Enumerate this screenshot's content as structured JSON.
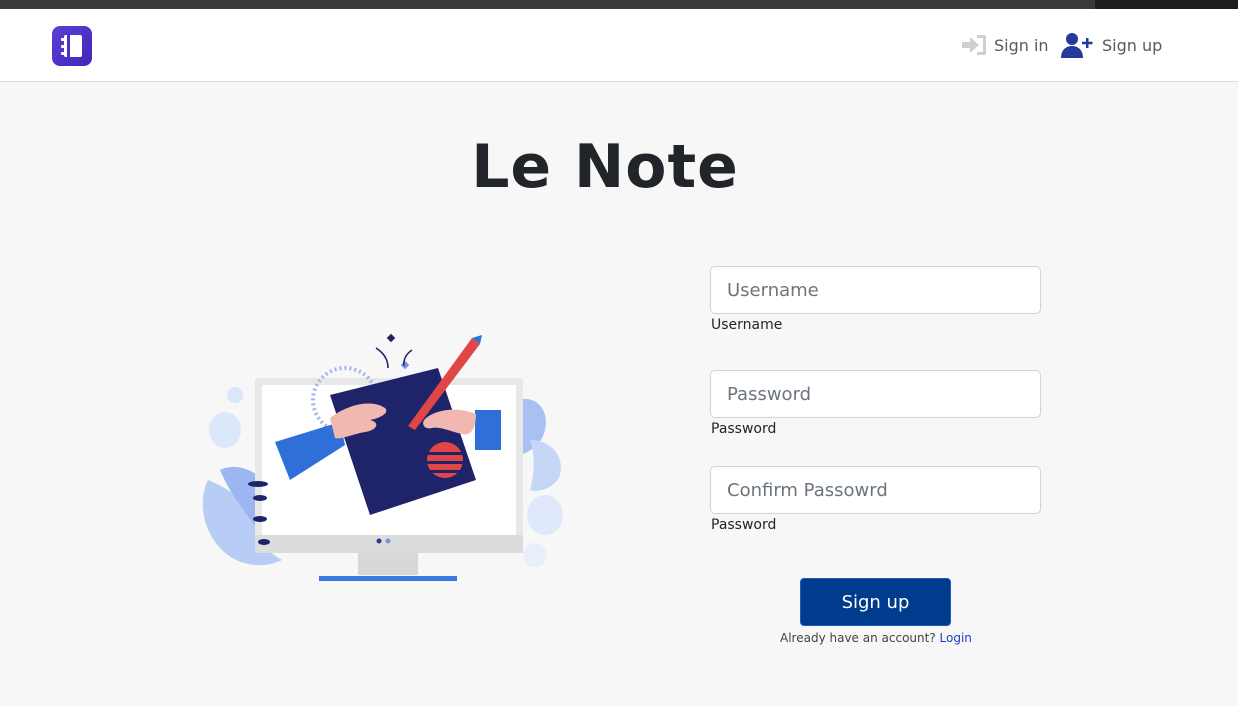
{
  "app": {
    "title": "Le Note"
  },
  "nav": {
    "signin_label": "Sign in",
    "signup_label": "Sign up"
  },
  "form": {
    "username": {
      "placeholder": "Username",
      "label": "Username",
      "value": ""
    },
    "password": {
      "placeholder": "Password",
      "label": "Password",
      "value": ""
    },
    "confirm": {
      "placeholder": "Confirm Passowrd",
      "label": "Password",
      "value": ""
    },
    "submit_label": "Sign up",
    "already_text": "Already have an account?",
    "login_link": "Login"
  },
  "colors": {
    "brand": "#4a2fc8",
    "primary_button": "#003b8e",
    "nav_icon": "#243a9c"
  },
  "icons": {
    "logo": "notebook-icon",
    "signin": "sign-in-icon",
    "signup": "user-plus-icon"
  }
}
